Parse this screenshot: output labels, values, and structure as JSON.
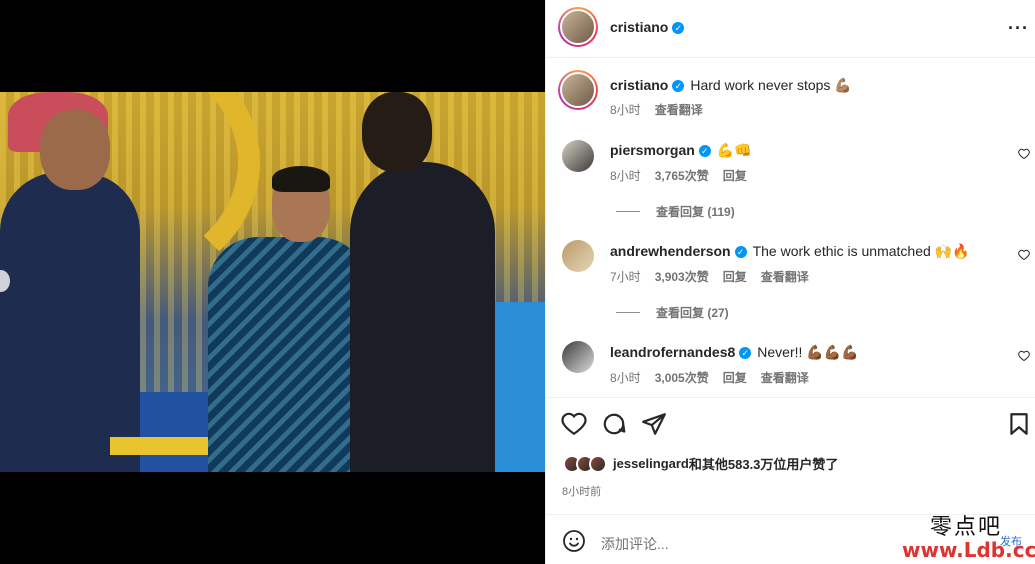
{
  "post": {
    "author": "cristiano",
    "caption_user": "cristiano",
    "caption": "Hard work never stops",
    "caption_emoji": "💪🏽",
    "caption_time": "8小时",
    "translate": "查看翻译",
    "more_icon": "more-horizontal-icon"
  },
  "carousel": {
    "count": 5,
    "active_index": 4
  },
  "comments": [
    {
      "user": "piersmorgan",
      "text": "",
      "emoji": "💪👊",
      "time": "8小时",
      "likes": "3,765次赞",
      "reply": "回复",
      "translate": "",
      "view_replies": "查看回复 (119)"
    },
    {
      "user": "andrewhenderson",
      "text": "The work ethic is unmatched",
      "emoji": "🙌🔥",
      "time": "7小时",
      "likes": "3,903次赞",
      "reply": "回复",
      "translate": "查看翻译",
      "view_replies": "查看回复 (27)"
    },
    {
      "user": "leandrofernandes8",
      "text": "Never!!",
      "emoji": "💪🏾💪🏾💪🏾",
      "time": "8小时",
      "likes": "3,005次赞",
      "reply": "回复",
      "translate": "查看翻译",
      "view_replies": ""
    }
  ],
  "actions": {
    "like_icon": "heart-icon",
    "comment_icon": "comment-icon",
    "share_icon": "send-icon",
    "save_icon": "bookmark-icon"
  },
  "likes": {
    "liker": "jesselingard",
    "rest": "和其他583.3万位用户赞了"
  },
  "post_time": "8小时前",
  "compose": {
    "placeholder": "添加评论...",
    "emoji_icon": "smile-icon"
  },
  "watermark": {
    "line1": "零点吧",
    "line2": "www.Ldb.cc",
    "line3": "发布"
  },
  "colors": {
    "verified": "#0095f6",
    "muted": "#737373",
    "text": "#262626"
  }
}
